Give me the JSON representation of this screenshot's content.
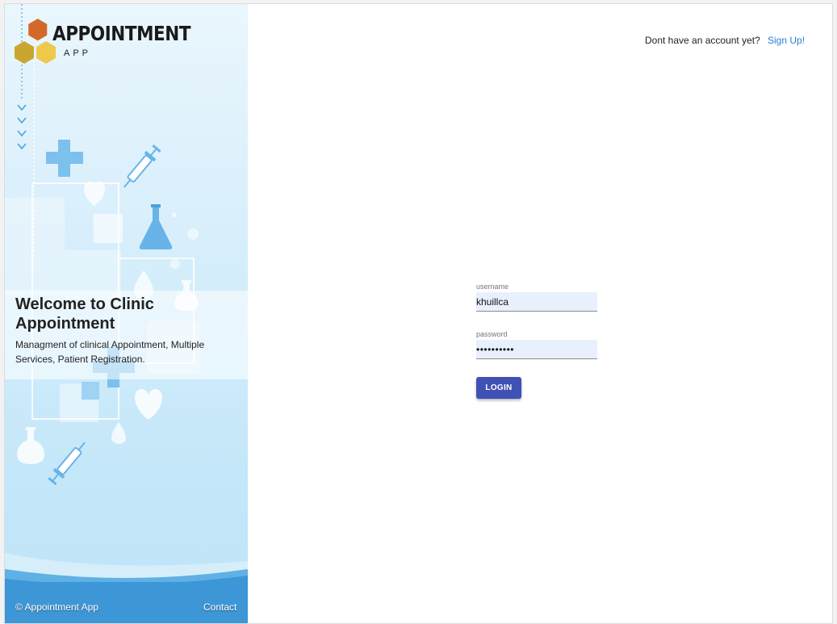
{
  "brand": {
    "title": "APPOINTMENT",
    "subtitle": "APP"
  },
  "welcome": {
    "title": "Welcome to Clinic Appointment",
    "description": "Managment of clinical Appointment, Multiple Services, Patient Registration."
  },
  "footer": {
    "copyright": "© Appointment App",
    "contact": "Contact"
  },
  "header": {
    "prompt": "Dont have an account yet?",
    "signup_link": "Sign Up!"
  },
  "form": {
    "username_label": "username",
    "username_value": "khuillca",
    "password_label": "password",
    "password_value": "••••••••••",
    "login_label": "LOGIN"
  },
  "colors": {
    "accent": "#3f51b5",
    "link": "#2a7fd4",
    "footer": "#3d96d6",
    "logo_orange": "#d2692a",
    "logo_olive": "#c9a62f",
    "logo_yellow": "#efc94c"
  },
  "icons": [
    "logo-hexagon-icon",
    "chevron-down-icon",
    "medical-cross-icon",
    "syringe-icon",
    "heart-icon",
    "flask-icon",
    "drop-icon"
  ]
}
